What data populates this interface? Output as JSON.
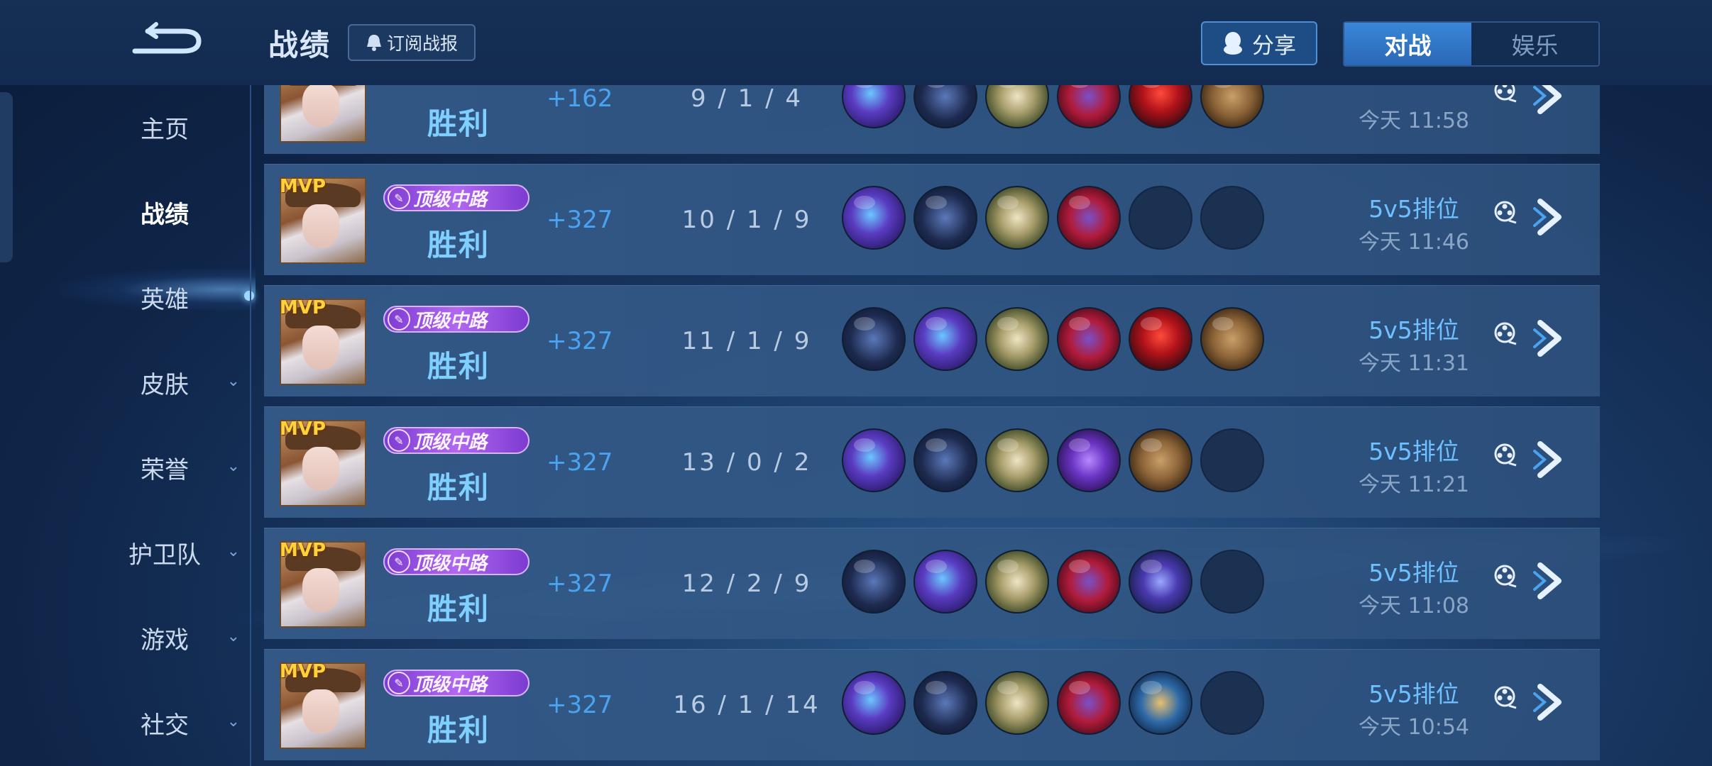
{
  "header": {
    "title": "战绩",
    "subscribe_label": "订阅战报",
    "share_label": "分享",
    "mode_tabs": [
      {
        "label": "对战",
        "active": true
      },
      {
        "label": "娱乐",
        "active": false
      }
    ]
  },
  "sidebar": {
    "items": [
      {
        "label": "主页",
        "has_chevron": false,
        "active": false
      },
      {
        "label": "战绩",
        "has_chevron": false,
        "active": true
      },
      {
        "label": "英雄",
        "has_chevron": false,
        "active": false
      },
      {
        "label": "皮肤",
        "has_chevron": true,
        "active": false
      },
      {
        "label": "荣誉",
        "has_chevron": true,
        "active": false
      },
      {
        "label": "护卫队",
        "has_chevron": true,
        "active": false
      },
      {
        "label": "游戏",
        "has_chevron": true,
        "active": false
      },
      {
        "label": "社交",
        "has_chevron": true,
        "active": false
      }
    ]
  },
  "matches": [
    {
      "mvp": "",
      "badge": "",
      "result": "胜利",
      "score": "+162",
      "kda": "9 / 1 / 4",
      "items": [
        "dragon",
        "boots",
        "book",
        "hat",
        "gem",
        "board"
      ],
      "mode": "5v5排位",
      "time": "今天 11:58"
    },
    {
      "mvp": "MVP",
      "badge": "顶级中路",
      "result": "胜利",
      "score": "+327",
      "kda": "10 / 1 / 9",
      "items": [
        "dragon",
        "boots",
        "book",
        "hat",
        "empty",
        "empty"
      ],
      "mode": "5v5排位",
      "time": "今天 11:46"
    },
    {
      "mvp": "MVP",
      "badge": "顶级中路",
      "result": "胜利",
      "score": "+327",
      "kda": "11 / 1 / 9",
      "items": [
        "boots",
        "dragon",
        "book",
        "hat",
        "gem",
        "board"
      ],
      "mode": "5v5排位",
      "time": "今天 11:31"
    },
    {
      "mvp": "MVP",
      "badge": "顶级中路",
      "result": "胜利",
      "score": "+327",
      "kda": "13 / 0 / 2",
      "items": [
        "dragon",
        "boots",
        "book",
        "staff",
        "board",
        "empty"
      ],
      "mode": "5v5排位",
      "time": "今天 11:21"
    },
    {
      "mvp": "MVP",
      "badge": "顶级中路",
      "result": "胜利",
      "score": "+327",
      "kda": "12 / 2 / 9",
      "items": [
        "boots",
        "dragon",
        "book",
        "hat",
        "orb",
        "empty"
      ],
      "mode": "5v5排位",
      "time": "今天 11:08"
    },
    {
      "mvp": "MVP",
      "badge": "顶级中路",
      "result": "胜利",
      "score": "+327",
      "kda": "16 / 1 / 14",
      "items": [
        "dragon",
        "boots",
        "book",
        "hat",
        "wand",
        "empty"
      ],
      "mode": "5v5排位",
      "time": "今天 10:54"
    }
  ],
  "icons": {
    "back": "back-arrow-icon",
    "subscribe": "bell-lock-icon",
    "share": "qq-penguin-icon",
    "replay": "replay-reel-icon",
    "next": "chevron-right-icon"
  },
  "colors": {
    "accent_blue": "#3a86d8",
    "victory_text": "#7fd0ff",
    "score_text": "#4aa3f0",
    "mvp_gold": "#ffd23a",
    "badge_purple": "#b168f0"
  }
}
